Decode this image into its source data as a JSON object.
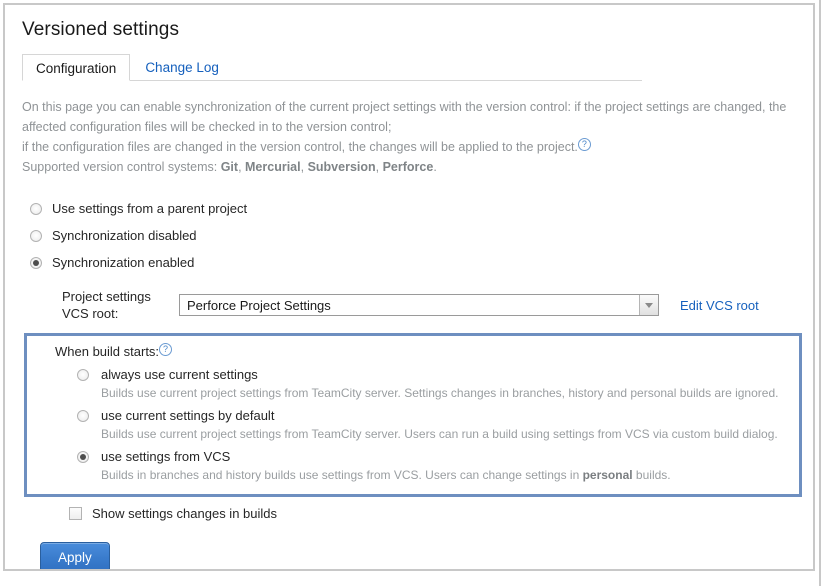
{
  "page": {
    "title": "Versioned settings"
  },
  "tabs": [
    {
      "label": "Configuration",
      "active": true
    },
    {
      "label": "Change Log",
      "active": false
    }
  ],
  "description": {
    "line1": "On this page you can enable synchronization of the current project settings with the version control: if the project settings are changed, the",
    "line2": "affected configuration files will be checked in to the version control;",
    "line3_prefix": "if the configuration files are changed in the version control, the changes will be applied to the project.",
    "help_icon": "help-circle-icon",
    "line4_prefix": "Supported version control systems: ",
    "vcs_systems": [
      "Git",
      "Mercurial",
      "Subversion",
      "Perforce"
    ],
    "line4_suffix": "."
  },
  "mode_options": [
    {
      "label": "Use settings from a parent project",
      "checked": false
    },
    {
      "label": "Synchronization disabled",
      "checked": false
    },
    {
      "label": "Synchronization enabled",
      "checked": true
    }
  ],
  "vcs_root": {
    "label_line1": "Project settings",
    "label_line2": "VCS root:",
    "selected_value": "Perforce Project Settings",
    "dropdown_icon": "chevron-down-icon",
    "edit_link": "Edit VCS root"
  },
  "when_build_starts": {
    "label": "When build starts:",
    "help_icon": "help-circle-icon",
    "options": [
      {
        "label": "always use current settings",
        "checked": false,
        "description": "Builds use current project settings from TeamCity server. Settings changes in branches, history and personal builds are ignored."
      },
      {
        "label": "use current settings by default",
        "checked": false,
        "description": "Builds use current project settings from TeamCity server. Users can run a build using settings from VCS via custom build dialog."
      },
      {
        "label": "use settings from VCS",
        "checked": true,
        "description_before": "Builds in branches and history builds use settings from VCS. Users can change settings in ",
        "description_bold": "personal",
        "description_after": " builds."
      }
    ],
    "highlight_color": "#6e8fc0"
  },
  "show_settings_changes": {
    "label": "Show settings changes in builds",
    "checked": false
  },
  "apply_button": {
    "label": "Apply",
    "color": "#3a7ccd"
  }
}
